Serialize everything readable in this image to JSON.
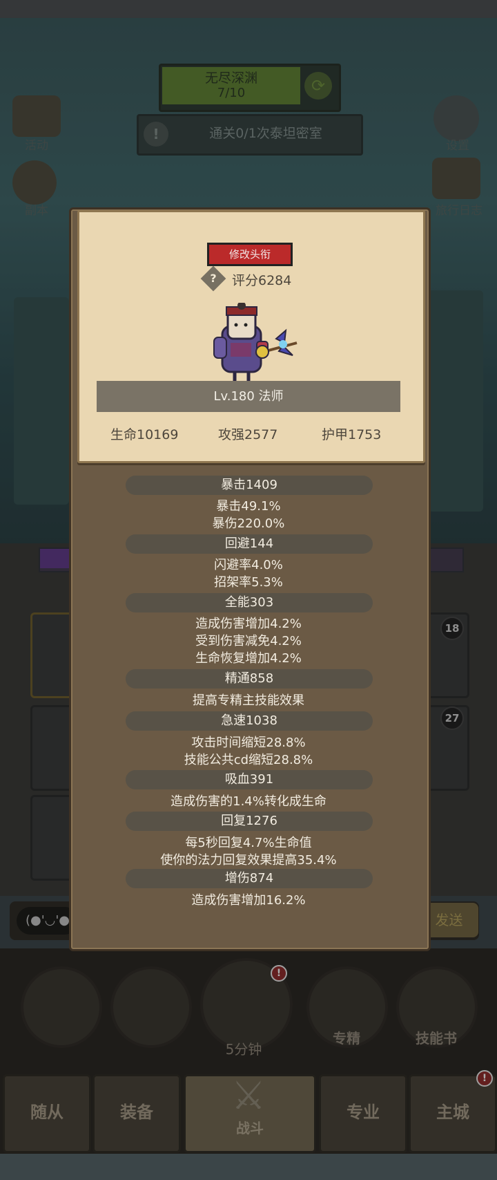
{
  "background": {
    "quest": {
      "title": "无尽深渊",
      "count": "7/10"
    },
    "task_text": "通关0/1次泰坦密室",
    "left_menu": [
      "活动",
      "副本"
    ],
    "right_menu": [
      "设置",
      "旅行日志"
    ],
    "slot_badges": [
      "18",
      "27"
    ],
    "chat_emote": "(●'◡'●",
    "send_label": "发送",
    "round_buttons": {
      "chest_timer": "5分钟",
      "specialize": "专精",
      "skill_book": "技能书"
    },
    "tabs": [
      "随从",
      "装备",
      "战斗",
      "专业",
      "主城"
    ],
    "alert_mark": "!"
  },
  "profile": {
    "rename_button": "修改头衔",
    "score_icon": "?",
    "score": "评分6284",
    "level_label": "Lv.180 法师",
    "base_stats": {
      "hp": "生命10169",
      "attack": "攻强2577",
      "armor": "护甲1753"
    }
  },
  "stats": [
    {
      "header": "暴击1409",
      "lines": [
        "暴击49.1%",
        "暴伤220.0%"
      ]
    },
    {
      "header": "回避144",
      "lines": [
        "闪避率4.0%",
        "招架率5.3%"
      ]
    },
    {
      "header": "全能303",
      "lines": [
        "造成伤害增加4.2%",
        "受到伤害减免4.2%",
        "生命恢复增加4.2%"
      ]
    },
    {
      "header": "精通858",
      "lines": [
        "提高专精主技能效果"
      ]
    },
    {
      "header": "急速1038",
      "lines": [
        "攻击时间缩短28.8%",
        "技能公共cd缩短28.8%"
      ]
    },
    {
      "header": "吸血391",
      "lines": [
        "造成伤害的1.4%转化成生命"
      ]
    },
    {
      "header": "回复1276",
      "lines": [
        "每5秒回复4.7%生命值",
        "使你的法力回复效果提高35.4%"
      ]
    },
    {
      "header": "增伤874",
      "lines": [
        "造成伤害增加16.2%"
      ]
    }
  ]
}
